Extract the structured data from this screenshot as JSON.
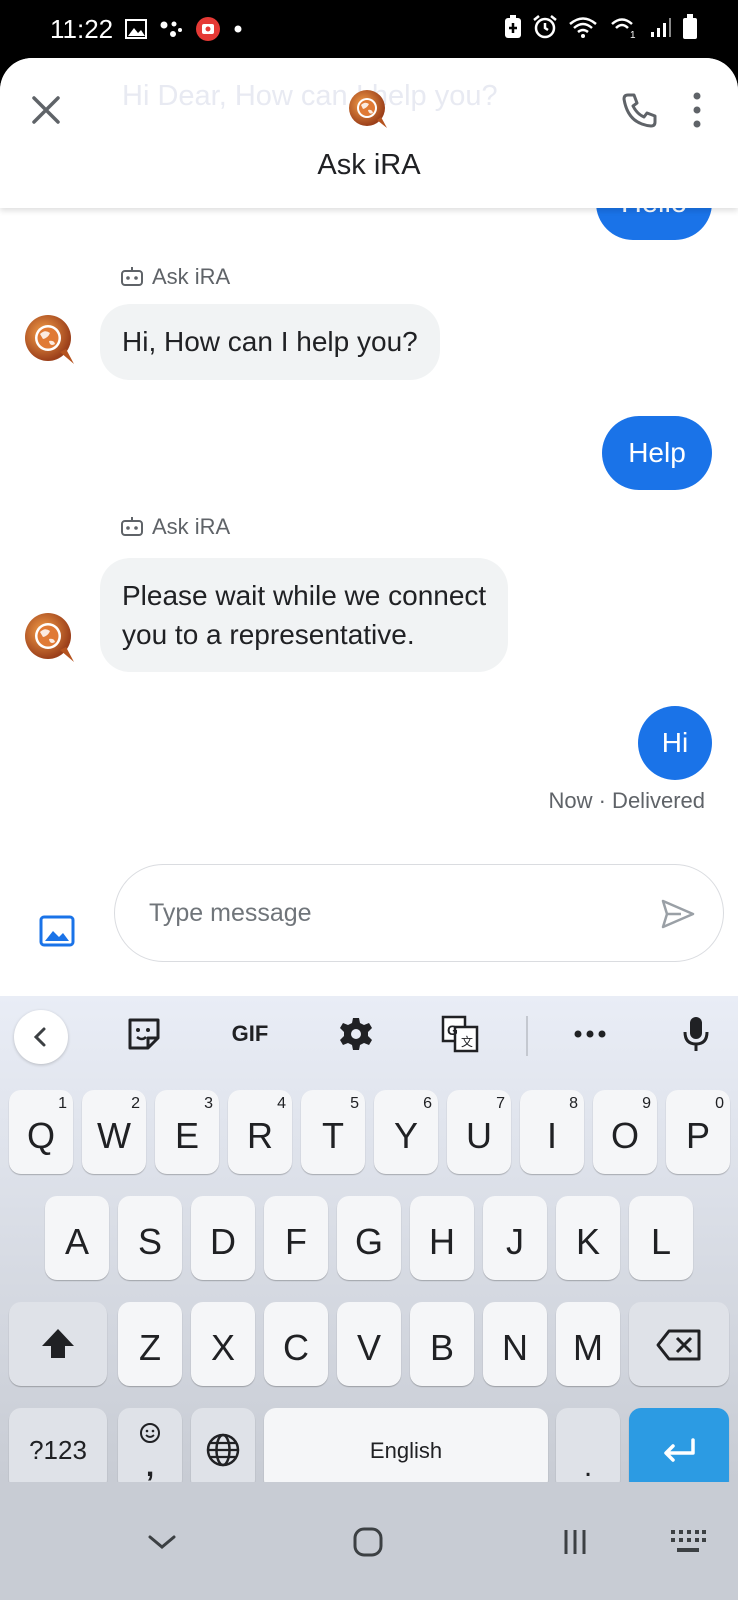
{
  "status_bar": {
    "time": "11:22"
  },
  "header": {
    "background_greeting": "Hi Dear, How can I help you?",
    "title": "Ask iRA"
  },
  "hidden_message": "Hello",
  "messages": [
    {
      "from": "bot",
      "sender": "Ask iRA",
      "text": "Hi, How can I help you?"
    },
    {
      "from": "user",
      "text": "Help"
    },
    {
      "from": "bot",
      "sender": "Ask iRA",
      "line1": "Please wait while we connect",
      "line2": "you to a representative."
    },
    {
      "from": "user",
      "text": "Hi"
    }
  ],
  "delivery_status": "Now · Delivered",
  "composer": {
    "placeholder": "Type message"
  },
  "keyboard": {
    "toolbar": {
      "gif": "GIF"
    },
    "row1": [
      {
        "l": "Q",
        "n": "1"
      },
      {
        "l": "W",
        "n": "2"
      },
      {
        "l": "E",
        "n": "3"
      },
      {
        "l": "R",
        "n": "4"
      },
      {
        "l": "T",
        "n": "5"
      },
      {
        "l": "Y",
        "n": "6"
      },
      {
        "l": "U",
        "n": "7"
      },
      {
        "l": "I",
        "n": "8"
      },
      {
        "l": "O",
        "n": "9"
      },
      {
        "l": "P",
        "n": "0"
      }
    ],
    "row2": [
      "A",
      "S",
      "D",
      "F",
      "G",
      "H",
      "J",
      "K",
      "L"
    ],
    "row3": [
      "Z",
      "X",
      "C",
      "V",
      "B",
      "N",
      "M"
    ],
    "symbols_key": "?123",
    "comma_key": ",",
    "space_label": "English",
    "period_key": "."
  },
  "colors": {
    "accent": "#1a73e8",
    "enter": "#2c9be3",
    "bubble_in": "#f1f3f4"
  }
}
